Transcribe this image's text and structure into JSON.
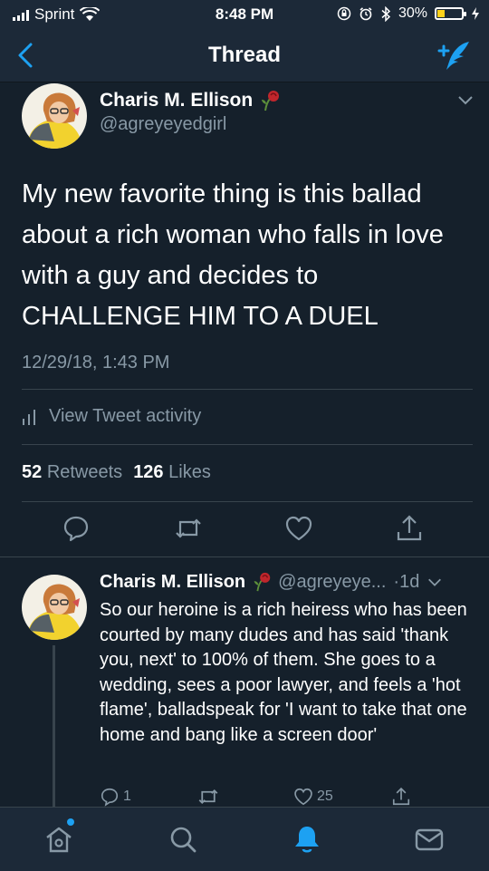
{
  "status_bar": {
    "carrier": "Sprint",
    "time": "8:48 PM",
    "battery": "30%",
    "battery_level": 0.3
  },
  "nav": {
    "title": "Thread"
  },
  "tweet": {
    "author_name": "Charis M. Ellison",
    "author_handle": "@agreyeyedgirl",
    "text": "My new favorite thing is this ballad about a rich woman who falls in love with a guy and decides to CHALLENGE HIM TO A DUEL",
    "timestamp": "12/29/18, 1:43 PM",
    "activity_label": "View Tweet activity",
    "retweets_count": "52",
    "retweets_label": "Retweets",
    "likes_count": "126",
    "likes_label": "Likes"
  },
  "reply": {
    "author_name": "Charis M. Ellison",
    "author_handle": "@agreyeye...",
    "time": "·1d",
    "text": "So our heroine is a rich heiress who has been courted by many dudes and has said 'thank you, next' to 100% of them. She goes to a wedding, sees a poor lawyer, and feels a 'hot flame', balladspeak for 'I want to take that one home and bang like a screen door'",
    "reply_count": "1",
    "like_count": "25"
  },
  "colors": {
    "background": "#15202b",
    "bar": "#1c2938",
    "accent": "#1da1f2",
    "muted": "#8899a6",
    "divider": "#38444d",
    "battery": "#ffd21a"
  },
  "icons": [
    "back-chevron-icon",
    "compose-tweet-icon",
    "rose-emoji-icon",
    "chevron-down-icon",
    "bar-chart-icon",
    "reply-icon",
    "retweet-icon",
    "like-icon",
    "share-icon",
    "home-icon",
    "search-icon",
    "notifications-icon",
    "messages-icon"
  ]
}
